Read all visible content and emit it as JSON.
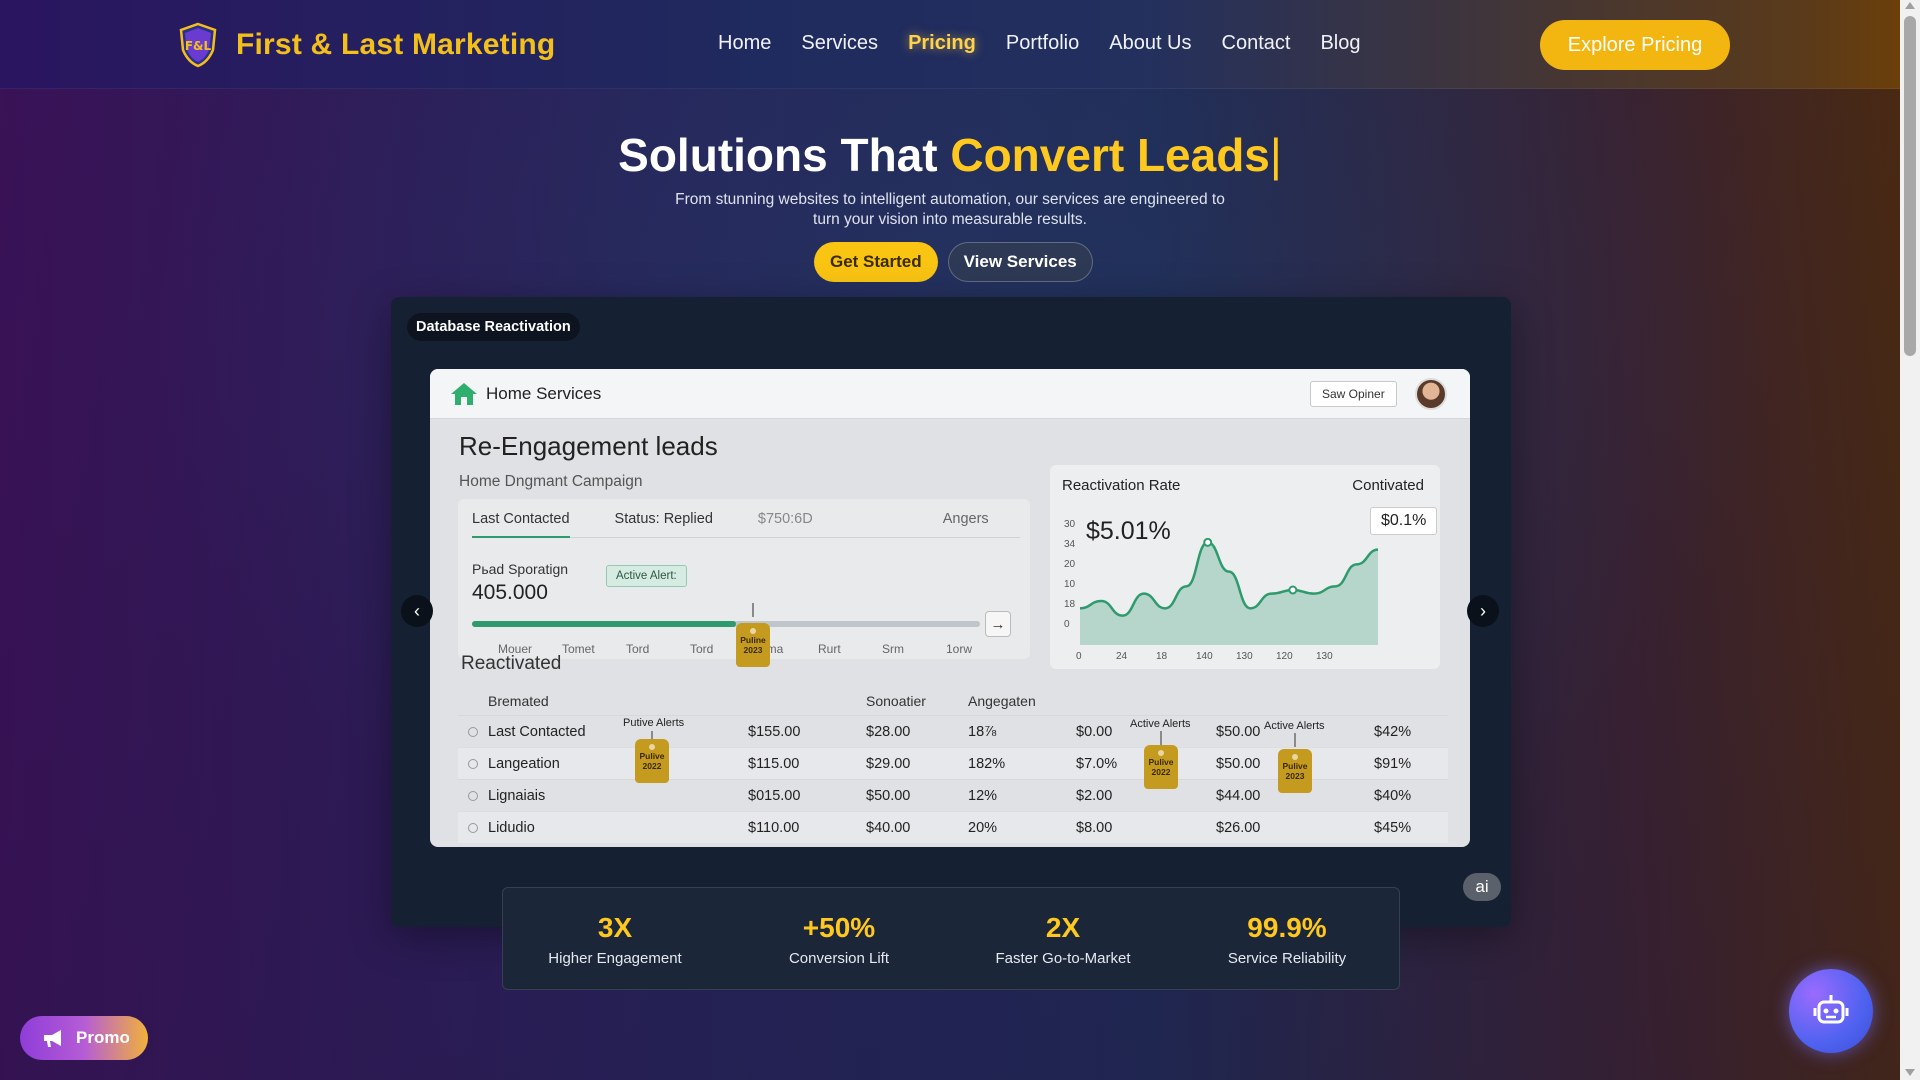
{
  "brand": {
    "name": "First & Last Marketing",
    "logo_text": "F&L"
  },
  "nav": {
    "links": [
      "Home",
      "Services",
      "Pricing",
      "Portfolio",
      "About Us",
      "Contact",
      "Blog"
    ],
    "active": "Pricing",
    "cta": "Explore Pricing"
  },
  "hero": {
    "title_plain": "Solutions That ",
    "title_highlight": "Convert Leads",
    "caret": "|",
    "subtitle": "From stunning websites to intelligent automation, our services are engineered to turn your vision into measurable results.",
    "primary_button": "Get Started",
    "secondary_button": "View Services"
  },
  "showcase": {
    "tag": "Database Reactivation",
    "ai_chip": "ai",
    "dashboard": {
      "app_name": "Home Services",
      "top_button": "Saw Opiner",
      "title": "Re-Engagement leads",
      "subtitle": "Home Dngmant Campaign",
      "tabs": [
        "Last Contacted",
        "Status: Replied",
        "$750:6D",
        "Angers"
      ],
      "metric_label": "Pьad Sporatign",
      "metric_value": "405.000",
      "alert_pill": "Active Alert:",
      "slider_progress": 0.52,
      "tick_labels": [
        "Mouer",
        "Tomet",
        "Tord",
        "Tord",
        "Toma",
        "Rurt",
        "Srm",
        "1orw"
      ],
      "slider_tag": "Puline 2023",
      "section_label": "Reactivated",
      "right_card": {
        "title": "Reactivation Rate",
        "right_label": "Contivated",
        "big_value": "$5.01%",
        "chip": "$0.1%"
      },
      "table": {
        "headers": [
          "Bremated",
          "",
          "Sonoatier",
          "Angegaten",
          "",
          "",
          ""
        ],
        "rows": [
          [
            "Last Contacted",
            "$155.00",
            "$28.00",
            "18⅞",
            "$0.00",
            "$50.00",
            "$42%"
          ],
          [
            "Langeation",
            "$115.00",
            "$29.00",
            "182%",
            "$7.0%",
            "$50.00",
            "$91%"
          ],
          [
            "Lignaiais",
            "$015.00",
            "$50.00",
            "12%",
            "$2.00",
            "$44.00",
            "$40%"
          ],
          [
            "Lidudio",
            "$110.00",
            "$40.00",
            "20%",
            "$8.00",
            "$26.00",
            "$45%"
          ]
        ],
        "tags": [
          {
            "label": "Putive Alerts",
            "text": "Pulive 2022"
          },
          {
            "label": "Active Alerts",
            "text": "Pulive 2022"
          },
          {
            "label": "Active Alerts",
            "text": "Pulive 2023"
          }
        ]
      }
    }
  },
  "chart_data": {
    "type": "area",
    "x": [
      "0",
      "24",
      "18",
      "140",
      "130",
      "120",
      "130"
    ],
    "y_ticks": [
      "30",
      "34",
      "20",
      "10",
      "18",
      "0"
    ],
    "series": [
      {
        "values": [
          10,
          12,
          8,
          14,
          10,
          16,
          28,
          20,
          10,
          14,
          15,
          14,
          16,
          22,
          26
        ]
      }
    ],
    "color": "#2e9a6e"
  },
  "stats": [
    {
      "value": "3X",
      "label": "Higher Engagement"
    },
    {
      "value": "+50%",
      "label": "Conversion Lift"
    },
    {
      "value": "2X",
      "label": "Faster Go-to-Market"
    },
    {
      "value": "99.9%",
      "label": "Service Reliability"
    }
  ],
  "promo": {
    "label": "Promo"
  },
  "icons": {
    "logo": "shield-logo-icon",
    "house": "house-icon",
    "megaphone": "megaphone-icon",
    "bot": "robot-icon",
    "prev": "chevron-left-icon",
    "next": "chevron-right-icon"
  },
  "colors": {
    "accent": "#ffc81e",
    "cta": "#f3b50f",
    "chart_green": "#2e9a6e"
  }
}
